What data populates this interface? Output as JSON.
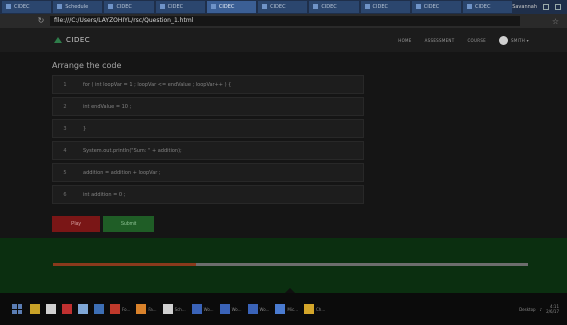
{
  "browser": {
    "tabs": [
      "CIDEC",
      "Schedule",
      "CIDEC",
      "CIDEC",
      "CIDEC",
      "CIDEC",
      "CIDEC",
      "CIDEC",
      "CIDEC",
      "CIDEC"
    ],
    "profile_label": "Savannah",
    "url": "file:///C:/Users/LAYZOHIYL/rsc/Question_1.html"
  },
  "app": {
    "logo_text": "CIDEC",
    "nav": [
      "HOME",
      "ASSESSMENT",
      "COURSE"
    ],
    "user": "SMITH ▾"
  },
  "exercise": {
    "title": "Arrange the code",
    "items": [
      {
        "num": "1",
        "code": "for ( int loopVar = 1 ; loopVar <= endValue ; loopVar++ ) {"
      },
      {
        "num": "2",
        "code": "int endValue = 10 ;"
      },
      {
        "num": "3",
        "code": "}"
      },
      {
        "num": "4",
        "code": "System.out.println(\"Sum: \" + addition);"
      },
      {
        "num": "5",
        "code": "addition = addition + loopVar ;"
      },
      {
        "num": "6",
        "code": "int addition = 0 ;"
      }
    ],
    "play_label": "Play",
    "submit_label": "Submit"
  },
  "progress": {
    "fraction": 0.3
  },
  "taskbar": {
    "items": [
      "",
      "",
      "",
      "",
      "",
      "Fo...",
      "Fa...",
      "Sch...",
      "Wo...",
      "Wo...",
      "Wo...",
      "Mic...",
      "Ch..."
    ],
    "tray_text": "Desktop",
    "time": "4:11",
    "date": "2/6/17"
  },
  "colors": {
    "accent": "#2e7d4a",
    "play": "#7a1616",
    "submit": "#1f5d26",
    "progress_fill": "#8a3a1c",
    "footer": "#0b2f10"
  }
}
